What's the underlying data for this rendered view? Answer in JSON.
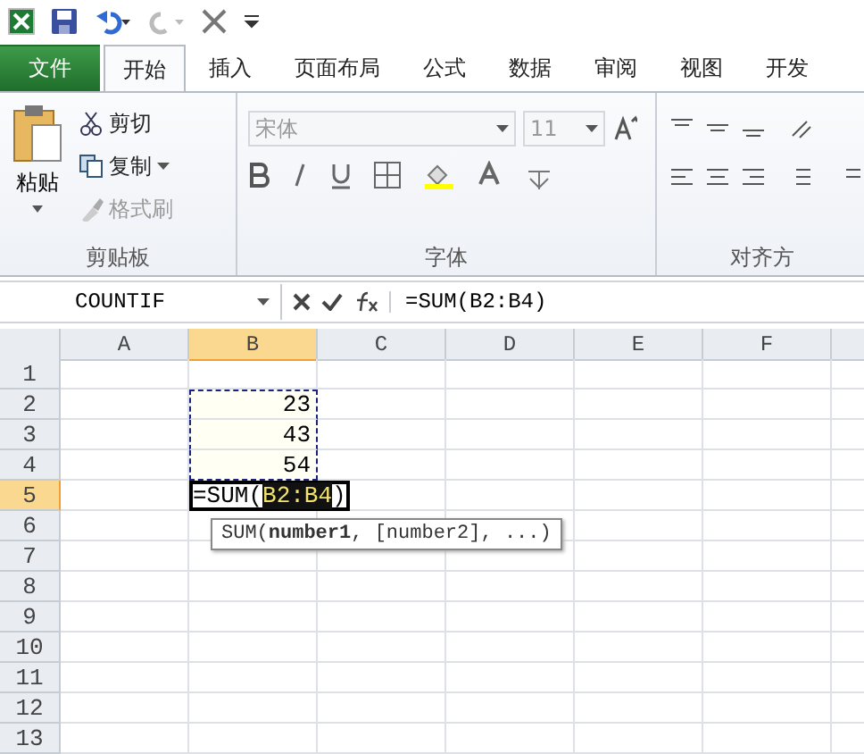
{
  "tabs": [
    {
      "label": "文件",
      "kind": "file",
      "selected": false
    },
    {
      "label": "开始",
      "kind": "tab",
      "selected": true
    },
    {
      "label": "插入",
      "kind": "tab",
      "selected": false
    },
    {
      "label": "页面布局",
      "kind": "tab",
      "selected": false
    },
    {
      "label": "公式",
      "kind": "tab",
      "selected": false
    },
    {
      "label": "数据",
      "kind": "tab",
      "selected": false
    },
    {
      "label": "审阅",
      "kind": "tab",
      "selected": false
    },
    {
      "label": "视图",
      "kind": "tab",
      "selected": false
    },
    {
      "label": "开发",
      "kind": "tab",
      "selected": false
    }
  ],
  "clipboard": {
    "paste": "粘贴",
    "cut": "剪切",
    "copy": "复制",
    "format_painter": {
      "label": "格式刷",
      "disabled": true
    },
    "group_label": "剪贴板"
  },
  "font": {
    "font_name": "宋体",
    "font_size": "11",
    "group_label": "字体"
  },
  "alignment": {
    "group_label": "对齐方"
  },
  "formula_bar": {
    "name_box": "COUNTIF",
    "formula": "=SUM(B2:B4)"
  },
  "columns": [
    {
      "label": "A",
      "selected": false
    },
    {
      "label": "B",
      "selected": true
    },
    {
      "label": "C",
      "selected": false
    },
    {
      "label": "D",
      "selected": false
    },
    {
      "label": "E",
      "selected": false
    },
    {
      "label": "F",
      "selected": false
    }
  ],
  "rows": [
    {
      "label": "1",
      "selected": false,
      "cells": [
        {},
        {},
        {},
        {},
        {},
        {}
      ]
    },
    {
      "label": "2",
      "selected": false,
      "cells": [
        {},
        {
          "text": "23",
          "marked": true
        },
        {},
        {},
        {},
        {}
      ]
    },
    {
      "label": "3",
      "selected": false,
      "cells": [
        {},
        {
          "text": "43",
          "marked": true
        },
        {},
        {},
        {},
        {}
      ]
    },
    {
      "label": "4",
      "selected": false,
      "cells": [
        {},
        {
          "text": "54",
          "marked": true
        },
        {},
        {},
        {},
        {}
      ]
    },
    {
      "label": "5",
      "selected": true,
      "cells": [
        {},
        {
          "kind": "editing",
          "prefix": "=SUM(",
          "ref": "B2:B4",
          "suffix": ")",
          "tooltip": "SUM(**number1**, [number2], ...)"
        },
        {},
        {},
        {},
        {}
      ]
    },
    {
      "label": "6",
      "selected": false,
      "cells": [
        {},
        {},
        {},
        {},
        {},
        {}
      ]
    },
    {
      "label": "7",
      "selected": false,
      "cells": [
        {},
        {},
        {},
        {},
        {},
        {}
      ]
    },
    {
      "label": "8",
      "selected": false,
      "cells": [
        {},
        {},
        {},
        {},
        {},
        {}
      ]
    },
    {
      "label": "9",
      "selected": false,
      "cells": [
        {},
        {},
        {},
        {},
        {},
        {}
      ]
    },
    {
      "label": "10",
      "selected": false,
      "cells": [
        {},
        {},
        {},
        {},
        {},
        {}
      ]
    },
    {
      "label": "11",
      "selected": false,
      "cells": [
        {},
        {},
        {},
        {},
        {},
        {}
      ]
    },
    {
      "label": "12",
      "selected": false,
      "cells": [
        {},
        {},
        {},
        {},
        {},
        {}
      ]
    },
    {
      "label": "13",
      "selected": false,
      "cells": [
        {},
        {},
        {},
        {},
        {},
        {}
      ]
    }
  ]
}
